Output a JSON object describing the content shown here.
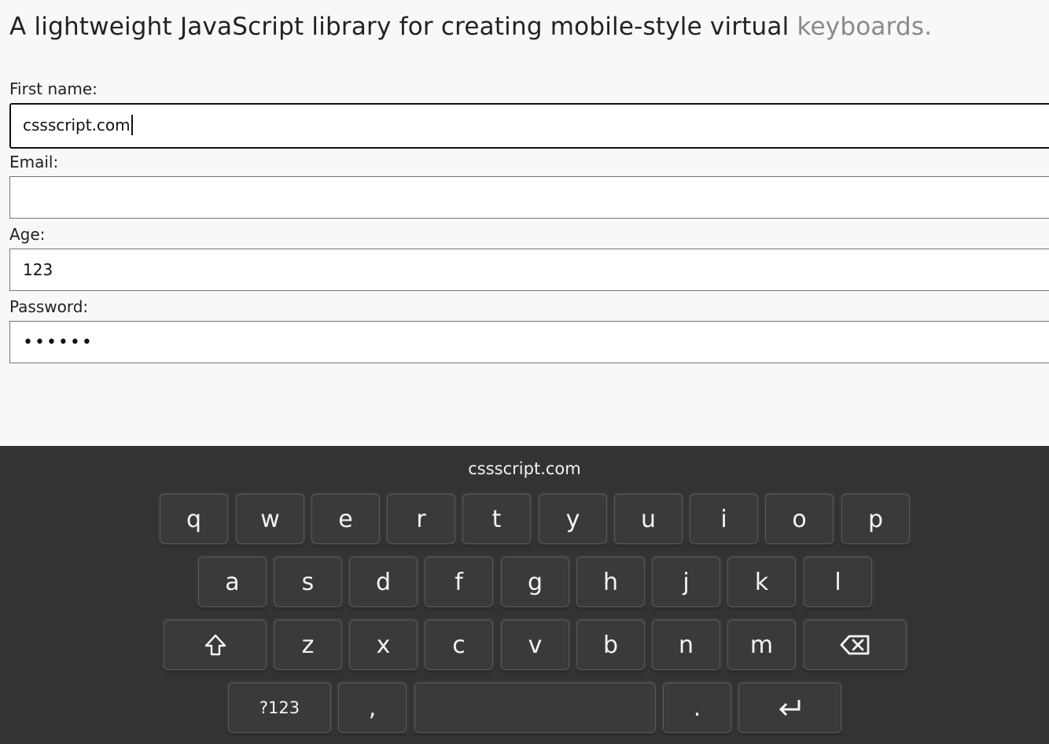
{
  "headline": {
    "main": "A lightweight JavaScript library for creating mobile-style virtual ",
    "faded": "keyboards."
  },
  "form": {
    "first_name_label": "First name:",
    "first_name_value": "cssscript.com",
    "email_label": "Email:",
    "email_value": "",
    "age_label": "Age:",
    "age_value": "123",
    "password_label": "Password:",
    "password_value": "••••••"
  },
  "keyboard": {
    "preview": "cssscript.com",
    "row1": [
      "q",
      "w",
      "e",
      "r",
      "t",
      "y",
      "u",
      "i",
      "o",
      "p"
    ],
    "row2": [
      "a",
      "s",
      "d",
      "f",
      "g",
      "h",
      "j",
      "k",
      "l"
    ],
    "row3": [
      "z",
      "x",
      "c",
      "v",
      "b",
      "n",
      "m"
    ],
    "numbers_label": "?123",
    "comma_label": ",",
    "period_label": ".",
    "icons": {
      "shift": "shift-arrow-up-icon",
      "backspace": "backspace-icon",
      "enter": "enter-return-icon"
    }
  },
  "colors": {
    "page_bg": "#f8f8f6",
    "keyboard_bg": "#333333",
    "key_bg": "#3a3a3a",
    "key_text": "#f4f4f4"
  }
}
